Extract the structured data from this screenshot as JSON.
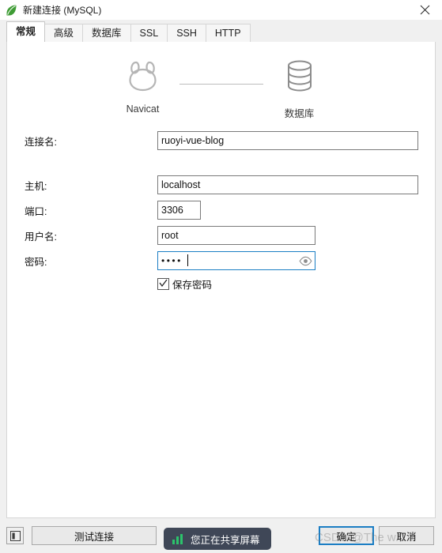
{
  "window": {
    "title": "新建连接 (MySQL)",
    "app_icon": "navicat-leaf-icon",
    "close_label": "✕"
  },
  "tabs": [
    {
      "label": "常规",
      "selected": true
    },
    {
      "label": "高级",
      "selected": false
    },
    {
      "label": "数据库",
      "selected": false
    },
    {
      "label": "SSL",
      "selected": false
    },
    {
      "label": "SSH",
      "selected": false
    },
    {
      "label": "HTTP",
      "selected": false
    }
  ],
  "graphic": {
    "source_label": "Navicat",
    "target_label": "数据库"
  },
  "form": {
    "connection_name": {
      "label": "连接名:",
      "value": "ruoyi-vue-blog"
    },
    "host": {
      "label": "主机:",
      "value": "localhost"
    },
    "port": {
      "label": "端口:",
      "value": "3306"
    },
    "username": {
      "label": "用户名:",
      "value": "root"
    },
    "password": {
      "label": "密码:",
      "value": "••••",
      "eye_icon": "eye-icon"
    },
    "save_password": {
      "label": "保存密码",
      "checked": true
    }
  },
  "bottom": {
    "panel_toggle_icon": "panel-toggle-icon",
    "test_label": "测试连接",
    "ok_label": "确定",
    "cancel_label": "取消"
  },
  "overlays": {
    "screen_share": {
      "text": "您正在共享屏幕",
      "icon": "signal-bars-icon",
      "bg": "#3f4757",
      "accent": "#2cc36b"
    },
    "watermark": "CSDN @The w..t ?"
  },
  "colors": {
    "window_bg": "#f0f0f0",
    "panel_bg": "#ffffff",
    "focus_blue": "#1b7ec4",
    "app_green": "#3f9c35"
  }
}
